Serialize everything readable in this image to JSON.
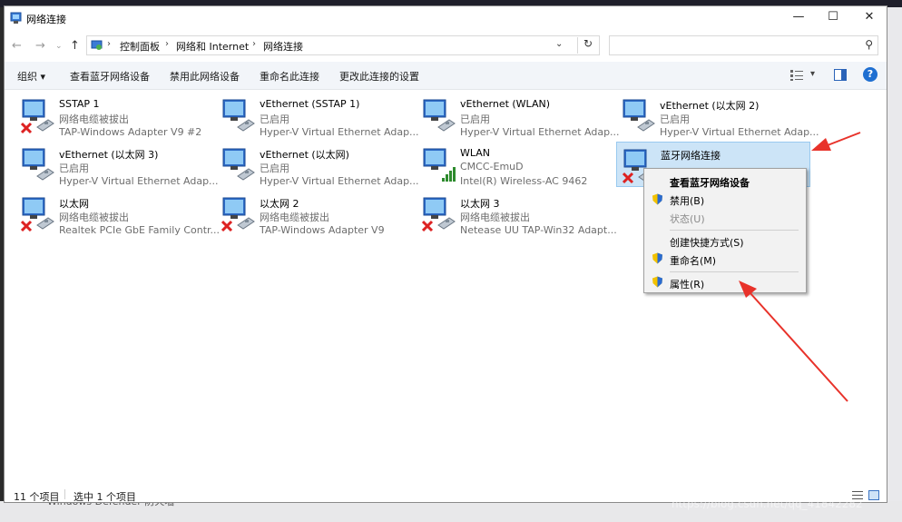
{
  "window": {
    "title": "网络连接",
    "minimize": "—",
    "maximize": "☐",
    "close": "✕"
  },
  "nav": {
    "back": "←",
    "forward": "→",
    "dropdown": "⌄",
    "up": "↑"
  },
  "address": {
    "crumbs": [
      "控制面板",
      "网络和 Internet",
      "网络连接"
    ],
    "separator": "›",
    "dropdown": "⌄",
    "refresh": "↻"
  },
  "search": {
    "placeholder": "",
    "icon": "⚲"
  },
  "toolbar": {
    "organize": "组织 ▾",
    "view_bluetooth": "查看蓝牙网络设备",
    "disable": "禁用此网络设备",
    "rename": "重命名此连接",
    "change_settings": "更改此连接的设置",
    "view_menu": "▾"
  },
  "connections": [
    {
      "name": "SSTAP 1",
      "status": "网络电缆被拔出",
      "adapter": "TAP-Windows Adapter V9 #2",
      "kind": "ethernet",
      "disconnected": true
    },
    {
      "name": "vEthernet (SSTAP 1)",
      "status": "已启用",
      "adapter": "Hyper-V Virtual Ethernet Adap...",
      "kind": "ethernet",
      "disconnected": false
    },
    {
      "name": "vEthernet (WLAN)",
      "status": "已启用",
      "adapter": "Hyper-V Virtual Ethernet Adap...",
      "kind": "ethernet",
      "disconnected": false
    },
    {
      "name": "vEthernet (以太网 2)",
      "status": "已启用",
      "adapter": "Hyper-V Virtual Ethernet Adap...",
      "kind": "ethernet",
      "disconnected": false
    },
    {
      "name": "vEthernet (以太网 3)",
      "status": "已启用",
      "adapter": "Hyper-V Virtual Ethernet Adap...",
      "kind": "ethernet",
      "disconnected": false
    },
    {
      "name": "vEthernet (以太网)",
      "status": "已启用",
      "adapter": "Hyper-V Virtual Ethernet Adap...",
      "kind": "ethernet",
      "disconnected": false
    },
    {
      "name": "WLAN",
      "status": "CMCC-EmuD",
      "adapter": "Intel(R) Wireless-AC 9462",
      "kind": "wifi",
      "disconnected": false
    },
    {
      "name": "蓝牙网络连接",
      "status": "",
      "adapter": "",
      "kind": "bluetooth",
      "disconnected": true
    },
    {
      "name": "以太网",
      "status": "网络电缆被拔出",
      "adapter": "Realtek PCIe GbE Family Contr...",
      "kind": "ethernet",
      "disconnected": true
    },
    {
      "name": "以太网 2",
      "status": "网络电缆被拔出",
      "adapter": "TAP-Windows Adapter V9",
      "kind": "ethernet",
      "disconnected": true
    },
    {
      "name": "以太网 3",
      "status": "网络电缆被拔出",
      "adapter": "Netease UU TAP-Win32 Adapt...",
      "kind": "ethernet",
      "disconnected": true
    }
  ],
  "context_menu": {
    "view_bluetooth": "查看蓝牙网络设备",
    "disable": "禁用(B)",
    "status": "状态(U)",
    "create_shortcut": "创建快捷方式(S)",
    "rename": "重命名(M)",
    "properties": "属性(R)"
  },
  "statusbar": {
    "count": "11 个项目",
    "selected": "选中 1 个项目"
  },
  "watermark": "https://blog.csdn.net/qq_41842282",
  "ghost_text": "Windows Defender 防火墙",
  "colors": {
    "selection": "#cce4f7",
    "arrow": "#e8322a",
    "help": "#1f6fd1",
    "toolbar_bg": "#f2f5f9"
  }
}
